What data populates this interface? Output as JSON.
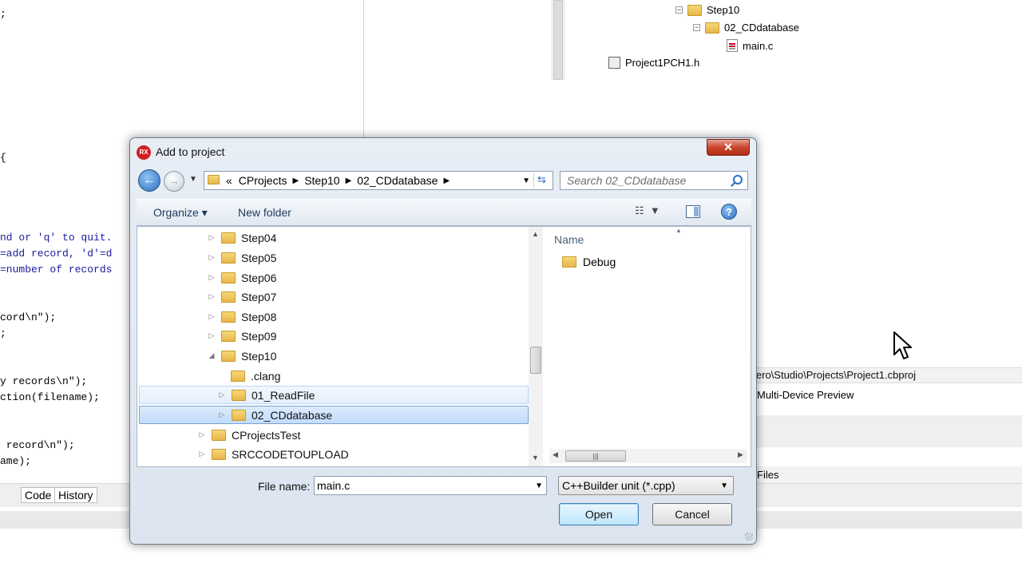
{
  "ide": {
    "code_lines": [
      {
        "text": ";",
        "blue": false
      },
      {
        "text": "{",
        "blue": false
      },
      {
        "text": "nd or 'q' to quit.",
        "blue": true
      },
      {
        "text": "=add record, 'd'=d",
        "blue": true
      },
      {
        "text": "=number of records",
        "blue": true
      },
      {
        "text": "cord\\n\");",
        "blue": false
      },
      {
        "text": ";",
        "blue": false
      },
      {
        "text": "y records\\n\");",
        "blue": false
      },
      {
        "text": "ction(filename);",
        "blue": false
      },
      {
        "text": " record\\n\");",
        "blue": false
      },
      {
        "text": "ame);",
        "blue": false
      }
    ],
    "project_tree": {
      "step10": "Step10",
      "cddatabase": "02_CDdatabase",
      "mainc": "main.c",
      "pch": "Project1PCH1.h"
    },
    "project_path": "lero\\Studio\\Projects\\Project1.cbproj",
    "multi_device": "Multi-Device Preview",
    "files_label": "Files",
    "code_tab": "Code",
    "history_tab": "History"
  },
  "dialog": {
    "title": "Add to project",
    "app_icon_text": "RX",
    "close_glyph": "✕",
    "breadcrumb": [
      "CProjects",
      "Step10",
      "02_CDdatabase"
    ],
    "breadcrumb_prefix": "«",
    "search_placeholder": "Search 02_CDdatabase",
    "toolbar": {
      "organize": "Organize ▾",
      "new_folder": "New folder",
      "help": "?"
    },
    "nav_tree": [
      {
        "label": "Step04",
        "expander": "▷",
        "state": ""
      },
      {
        "label": "Step05",
        "expander": "▷",
        "state": ""
      },
      {
        "label": "Step06",
        "expander": "▷",
        "state": ""
      },
      {
        "label": "Step07",
        "expander": "▷",
        "state": ""
      },
      {
        "label": "Step08",
        "expander": "▷",
        "state": ""
      },
      {
        "label": "Step09",
        "expander": "▷",
        "state": ""
      },
      {
        "label": "Step10",
        "expander": "◢",
        "state": ""
      },
      {
        "label": ".clang",
        "expander": "",
        "state": ""
      },
      {
        "label": "01_ReadFile",
        "expander": "▷",
        "state": "hover"
      },
      {
        "label": "02_CDdatabase",
        "expander": "▷",
        "state": "selected"
      },
      {
        "label": "CProjectsTest",
        "expander": "▷",
        "state": ""
      },
      {
        "label": "SRCCODETOUPLOAD",
        "expander": "▷",
        "state": ""
      }
    ],
    "column_header": "Name",
    "files": [
      {
        "name": "Debug",
        "icon": "folder-icon"
      }
    ],
    "file_name_label": "File name:",
    "file_name_value": "main.c",
    "file_type": "C++Builder unit (*.cpp)",
    "open_label": "Open",
    "cancel_label": "Cancel"
  },
  "colors": {
    "accent": "#2a6fc1",
    "selection": "#c1dcfc",
    "close_red": "#c9452d"
  }
}
